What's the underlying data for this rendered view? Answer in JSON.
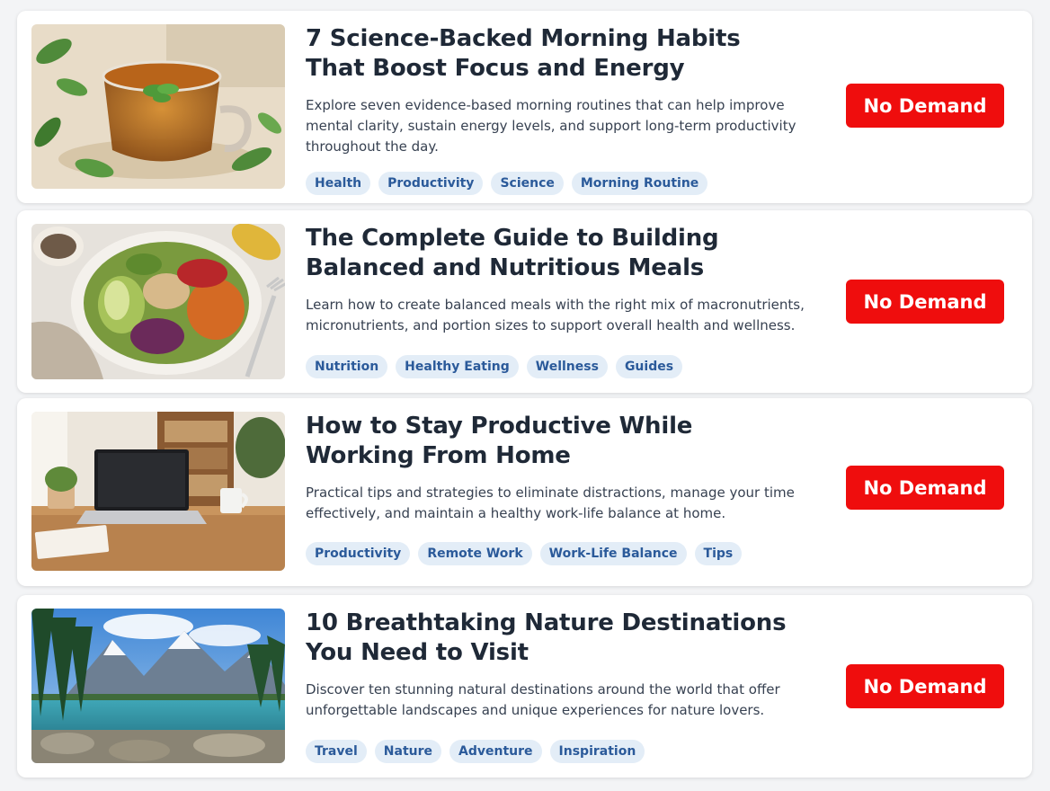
{
  "articles": [
    {
      "title_line1": "7 Science-Backed Morning Habits",
      "title_line2": "That Boost Focus and Energy",
      "description": "Explore seven evidence-based morning routines that can help improve mental clarity, sustain energy levels, and support long-term productivity throughout the day.",
      "tags": [
        "Health",
        "Productivity",
        "Science",
        "Morning Routine"
      ],
      "status_label": "No Demand",
      "image": "tea-cup-with-leaves"
    },
    {
      "title_line1": "The Complete Guide to Building",
      "title_line2": "Balanced and Nutritious Meals",
      "description": "Learn how to create balanced meals with the right mix of macronutrients, micronutrients, and portion sizes to support overall health and wellness.",
      "tags": [
        "Nutrition",
        "Healthy Eating",
        "Wellness",
        "Guides"
      ],
      "status_label": "No Demand",
      "image": "salad-bowl"
    },
    {
      "title_line1": "How to Stay Productive While",
      "title_line2": "Working From Home",
      "description": "Practical tips and strategies to eliminate distractions, manage your time effectively, and maintain a healthy work-life balance at home.",
      "tags": [
        "Productivity",
        "Remote Work",
        "Work-Life Balance",
        "Tips"
      ],
      "status_label": "No Demand",
      "image": "laptop-on-desk"
    },
    {
      "title_line1": "10 Breathtaking Nature Destinations",
      "title_line2": "You Need to Visit",
      "description": "Discover ten stunning natural destinations around the world that offer unforgettable landscapes and unique experiences for nature lovers.",
      "tags": [
        "Travel",
        "Nature",
        "Adventure",
        "Inspiration"
      ],
      "status_label": "No Demand",
      "image": "mountain-lake"
    }
  ],
  "colors": {
    "status_button": "#ef0d0d",
    "tag_bg": "#e3edf7",
    "tag_text": "#2b5a9a"
  }
}
